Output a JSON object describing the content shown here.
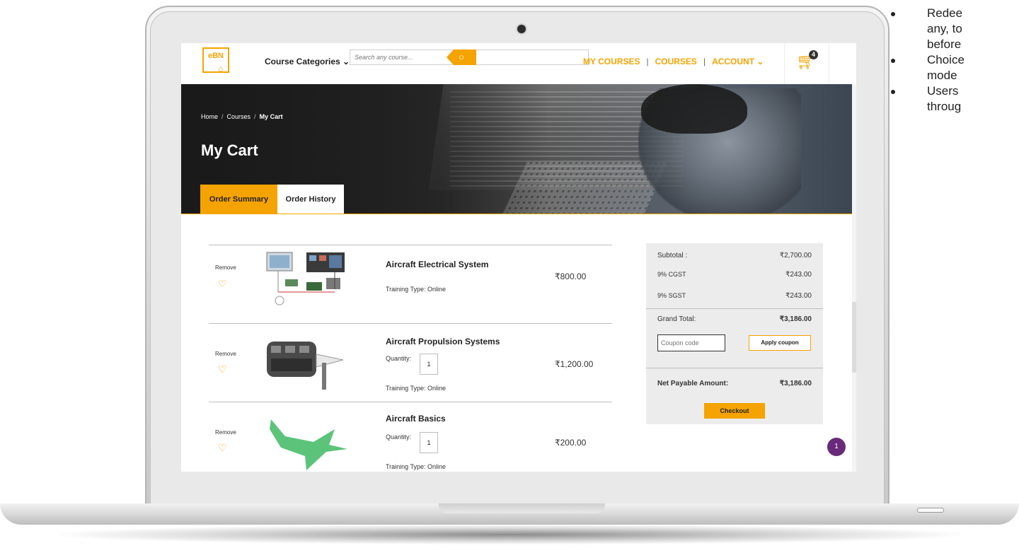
{
  "header": {
    "logo_text": "eBN",
    "course_categories": "Course Categories",
    "search_placeholder": "Search any course...",
    "nav": [
      "MY COURSES",
      "COURSES",
      "ACCOUNT"
    ],
    "cart_count": "4"
  },
  "hero": {
    "breadcrumb": [
      "Home",
      "Courses",
      "My Cart"
    ],
    "title": "My Cart",
    "tabs": [
      "Order Summary",
      "Order History"
    ]
  },
  "cart": {
    "remove_label": "Remove",
    "quantity_label": "Quantity:",
    "items": [
      {
        "title": "Aircraft Electrical System",
        "price": "₹800.00",
        "training_type": "Training Type: Online",
        "quantity": ""
      },
      {
        "title": "Aircraft Propulsion Systems",
        "price": "₹1,200.00",
        "training_type": "Training Type: Online",
        "quantity": "1"
      },
      {
        "title": "Aircraft Basics",
        "price": "₹200.00",
        "training_type": "Training Type: Online",
        "quantity": "1"
      }
    ]
  },
  "summary": {
    "subtotal_label": "Subtotal :",
    "subtotal": "₹2,700.00",
    "cgst_label": "9% CGST",
    "cgst": "₹243.00",
    "sgst_label": "9% SGST",
    "sgst": "₹243.00",
    "grand_total_label": "Grand Total:",
    "grand_total": "₹3,186.00",
    "coupon_placeholder": "Coupon code",
    "apply_coupon": "Apply coupon",
    "net_payable_label": "Net Payable Amount:",
    "net_payable": "₹3,186.00",
    "checkout": "Checkout"
  },
  "chat_badge": "1",
  "side_notes": [
    "Redee",
    "any, to",
    "before",
    "Choice",
    "mode",
    "Users",
    "throug"
  ],
  "colors": {
    "accent": "#f5a300",
    "dark_bg": "#2a2a2a",
    "summary_bg": "#ececec",
    "chat": "#6a2a7a"
  }
}
